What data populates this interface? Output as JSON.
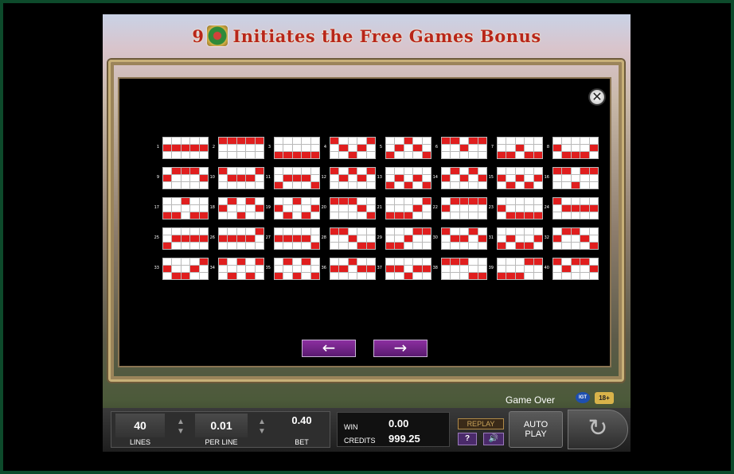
{
  "title": {
    "count": "9",
    "text": "Initiates the Free Games Bonus",
    "symbol_icon": "bonus-gem-icon"
  },
  "close_icon": "close-icon",
  "paylines": [
    {
      "n": "1",
      "on": [
        5,
        6,
        7,
        8,
        9
      ]
    },
    {
      "n": "2",
      "on": [
        0,
        1,
        2,
        3,
        4
      ]
    },
    {
      "n": "3",
      "on": [
        10,
        11,
        12,
        13,
        14
      ]
    },
    {
      "n": "4",
      "on": [
        0,
        6,
        12,
        8,
        4
      ]
    },
    {
      "n": "5",
      "on": [
        10,
        6,
        2,
        8,
        14
      ]
    },
    {
      "n": "6",
      "on": [
        0,
        1,
        7,
        3,
        4
      ]
    },
    {
      "n": "7",
      "on": [
        10,
        11,
        7,
        13,
        14
      ]
    },
    {
      "n": "8",
      "on": [
        5,
        11,
        12,
        13,
        9
      ]
    },
    {
      "n": "9",
      "on": [
        5,
        1,
        2,
        3,
        9
      ]
    },
    {
      "n": "10",
      "on": [
        0,
        6,
        7,
        8,
        4
      ]
    },
    {
      "n": "11",
      "on": [
        10,
        6,
        7,
        8,
        14
      ]
    },
    {
      "n": "12",
      "on": [
        0,
        6,
        2,
        8,
        4
      ]
    },
    {
      "n": "13",
      "on": [
        10,
        6,
        12,
        8,
        14
      ]
    },
    {
      "n": "14",
      "on": [
        5,
        1,
        7,
        3,
        9
      ]
    },
    {
      "n": "15",
      "on": [
        5,
        11,
        7,
        13,
        9
      ]
    },
    {
      "n": "16",
      "on": [
        0,
        1,
        12,
        3,
        4
      ]
    },
    {
      "n": "17",
      "on": [
        10,
        11,
        2,
        13,
        14
      ]
    },
    {
      "n": "18",
      "on": [
        5,
        1,
        12,
        3,
        9
      ]
    },
    {
      "n": "19",
      "on": [
        5,
        11,
        2,
        13,
        9
      ]
    },
    {
      "n": "20",
      "on": [
        0,
        1,
        2,
        8,
        14
      ]
    },
    {
      "n": "21",
      "on": [
        10,
        11,
        12,
        8,
        4
      ]
    },
    {
      "n": "22",
      "on": [
        5,
        1,
        2,
        3,
        4
      ]
    },
    {
      "n": "23",
      "on": [
        5,
        11,
        12,
        13,
        14
      ]
    },
    {
      "n": "24",
      "on": [
        0,
        6,
        7,
        8,
        9
      ]
    },
    {
      "n": "25",
      "on": [
        10,
        6,
        7,
        8,
        9
      ]
    },
    {
      "n": "26",
      "on": [
        5,
        6,
        7,
        8,
        4
      ]
    },
    {
      "n": "27",
      "on": [
        5,
        6,
        7,
        8,
        14
      ]
    },
    {
      "n": "28",
      "on": [
        0,
        1,
        7,
        13,
        14
      ]
    },
    {
      "n": "29",
      "on": [
        10,
        11,
        7,
        3,
        4
      ]
    },
    {
      "n": "30",
      "on": [
        0,
        6,
        7,
        3,
        9
      ]
    },
    {
      "n": "31",
      "on": [
        10,
        6,
        12,
        13,
        9
      ]
    },
    {
      "n": "32",
      "on": [
        5,
        1,
        2,
        8,
        14
      ]
    },
    {
      "n": "33",
      "on": [
        5,
        11,
        12,
        8,
        4
      ]
    },
    {
      "n": "34",
      "on": [
        0,
        11,
        2,
        13,
        4
      ]
    },
    {
      "n": "35",
      "on": [
        10,
        1,
        12,
        3,
        14
      ]
    },
    {
      "n": "36",
      "on": [
        5,
        6,
        2,
        8,
        9
      ]
    },
    {
      "n": "37",
      "on": [
        5,
        6,
        12,
        8,
        9
      ]
    },
    {
      "n": "38",
      "on": [
        0,
        1,
        2,
        13,
        14
      ]
    },
    {
      "n": "39",
      "on": [
        10,
        11,
        12,
        3,
        4
      ]
    },
    {
      "n": "40",
      "on": [
        0,
        6,
        2,
        3,
        9
      ]
    }
  ],
  "nav": {
    "prev": "←",
    "next": "→",
    "prev_icon": "arrow-left-icon",
    "next_icon": "arrow-right-icon"
  },
  "status": {
    "game_over": "Game Over",
    "igt": "IGT",
    "age": "18+"
  },
  "controls": {
    "lines_value": "40",
    "lines_label": "LINES",
    "per_line_value": "0.01",
    "per_line_label": "PER LINE",
    "bet_value": "0.40",
    "bet_label": "BET",
    "stepper_up": "▲",
    "stepper_down": "▼",
    "win_label": "WIN",
    "win_value": "0.00",
    "credits_label": "CREDITS",
    "credits_value": "999.25",
    "replay": "REPLAY",
    "help": "?",
    "sound": "🔊",
    "autoplay_line1": "AUTO",
    "autoplay_line2": "PLAY",
    "spin_icon": "↻"
  },
  "colors": {
    "payline_on": "#e01e1e",
    "payline_off": "#ffffff",
    "title": "#b8261a",
    "nav_button": "#6e2484"
  }
}
